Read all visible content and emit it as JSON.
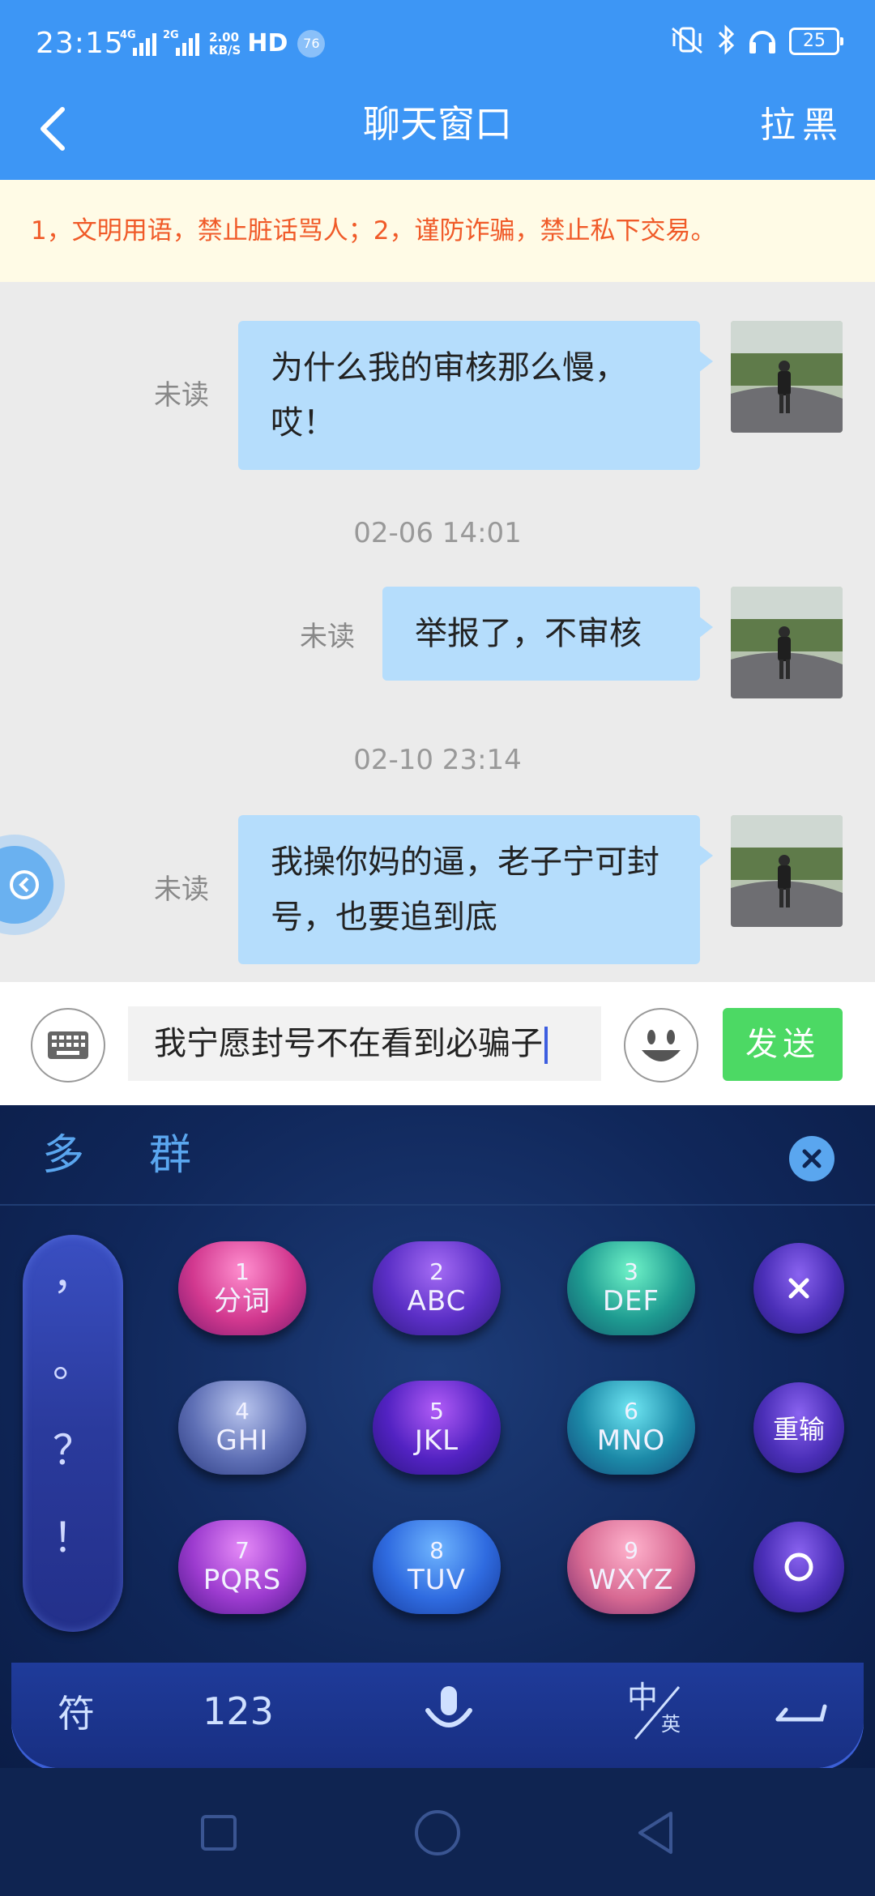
{
  "status_bar": {
    "time": "23:15",
    "signal1_label": "4G",
    "signal2_label": "2G",
    "speed_value": "2.00",
    "speed_unit": "KB/S",
    "hd_label": "HD",
    "notification_count": "76",
    "battery_level": "25"
  },
  "header": {
    "title": "聊天窗口",
    "block_label": "拉黑"
  },
  "notice": "1，文明用语，禁止脏话骂人；2，谨防诈骗，禁止私下交易。",
  "messages": [
    {
      "text": "为什么我的审核那么慢，哎！",
      "status": "未读"
    },
    {
      "timestamp": "02-06 14:01",
      "text": "举报了，不审核",
      "status": "未读"
    },
    {
      "timestamp": "02-10 23:14",
      "text": "我操你妈的逼，老子宁可封号，也要追到底",
      "status": "未读"
    }
  ],
  "input": {
    "value": "我宁愿封号不在看到必骗子",
    "send_label": "发送"
  },
  "keyboard": {
    "candidates": [
      "多",
      "群"
    ],
    "punctuation": [
      "，",
      "。",
      "？",
      "！"
    ],
    "keys": [
      {
        "num": "1",
        "letters": "分词"
      },
      {
        "num": "2",
        "letters": "ABC"
      },
      {
        "num": "3",
        "letters": "DEF"
      },
      {
        "num": "4",
        "letters": "GHI"
      },
      {
        "num": "5",
        "letters": "JKL"
      },
      {
        "num": "6",
        "letters": "MNO"
      },
      {
        "num": "7",
        "letters": "PQRS"
      },
      {
        "num": "8",
        "letters": "TUV"
      },
      {
        "num": "9",
        "letters": "WXYZ"
      }
    ],
    "rewrite_label": "重输",
    "symbols_label": "符",
    "numbers_label": "123",
    "lang_top": "中",
    "lang_bottom": "英"
  },
  "colors": {
    "header_bg": "#3d96f5",
    "notice_text": "#f05a28",
    "bubble_bg": "#b5ddfc",
    "send_bg": "#4cd964"
  }
}
